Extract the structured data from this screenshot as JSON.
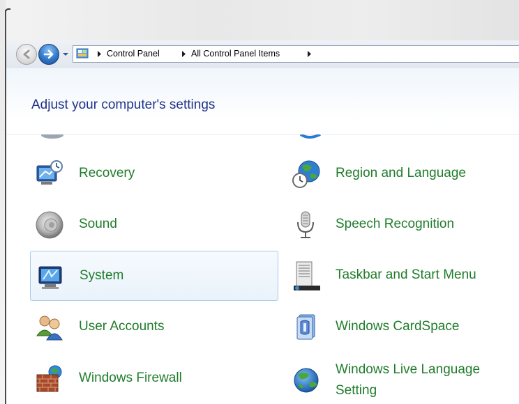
{
  "navigation": {
    "back_label": "Back",
    "forward_label": "Forward",
    "breadcrumbs": [
      "Control Panel",
      "All Control Panel Items"
    ]
  },
  "header": {
    "title": "Adjust your computer's settings"
  },
  "items_left": [
    {
      "label": "Recovery",
      "icon": "recovery-icon"
    },
    {
      "label": "Sound",
      "icon": "speaker-icon"
    },
    {
      "label": "System",
      "icon": "system-icon",
      "selected": true
    },
    {
      "label": "User Accounts",
      "icon": "users-icon"
    },
    {
      "label": "Windows Firewall",
      "icon": "firewall-icon"
    }
  ],
  "items_right": [
    {
      "label": "Region and Language",
      "icon": "globe-clock-icon"
    },
    {
      "label": "Speech Recognition",
      "icon": "microphone-icon"
    },
    {
      "label": "Taskbar and Start Menu",
      "icon": "taskbar-icon"
    },
    {
      "label": "Windows CardSpace",
      "icon": "cardspace-icon"
    },
    {
      "label": "Windows Live Language Setting",
      "icon": "globe-icon"
    }
  ],
  "colors": {
    "title": "#1e3287",
    "item_label": "#1f7c2b",
    "selection_border": "#a9c9ea"
  }
}
